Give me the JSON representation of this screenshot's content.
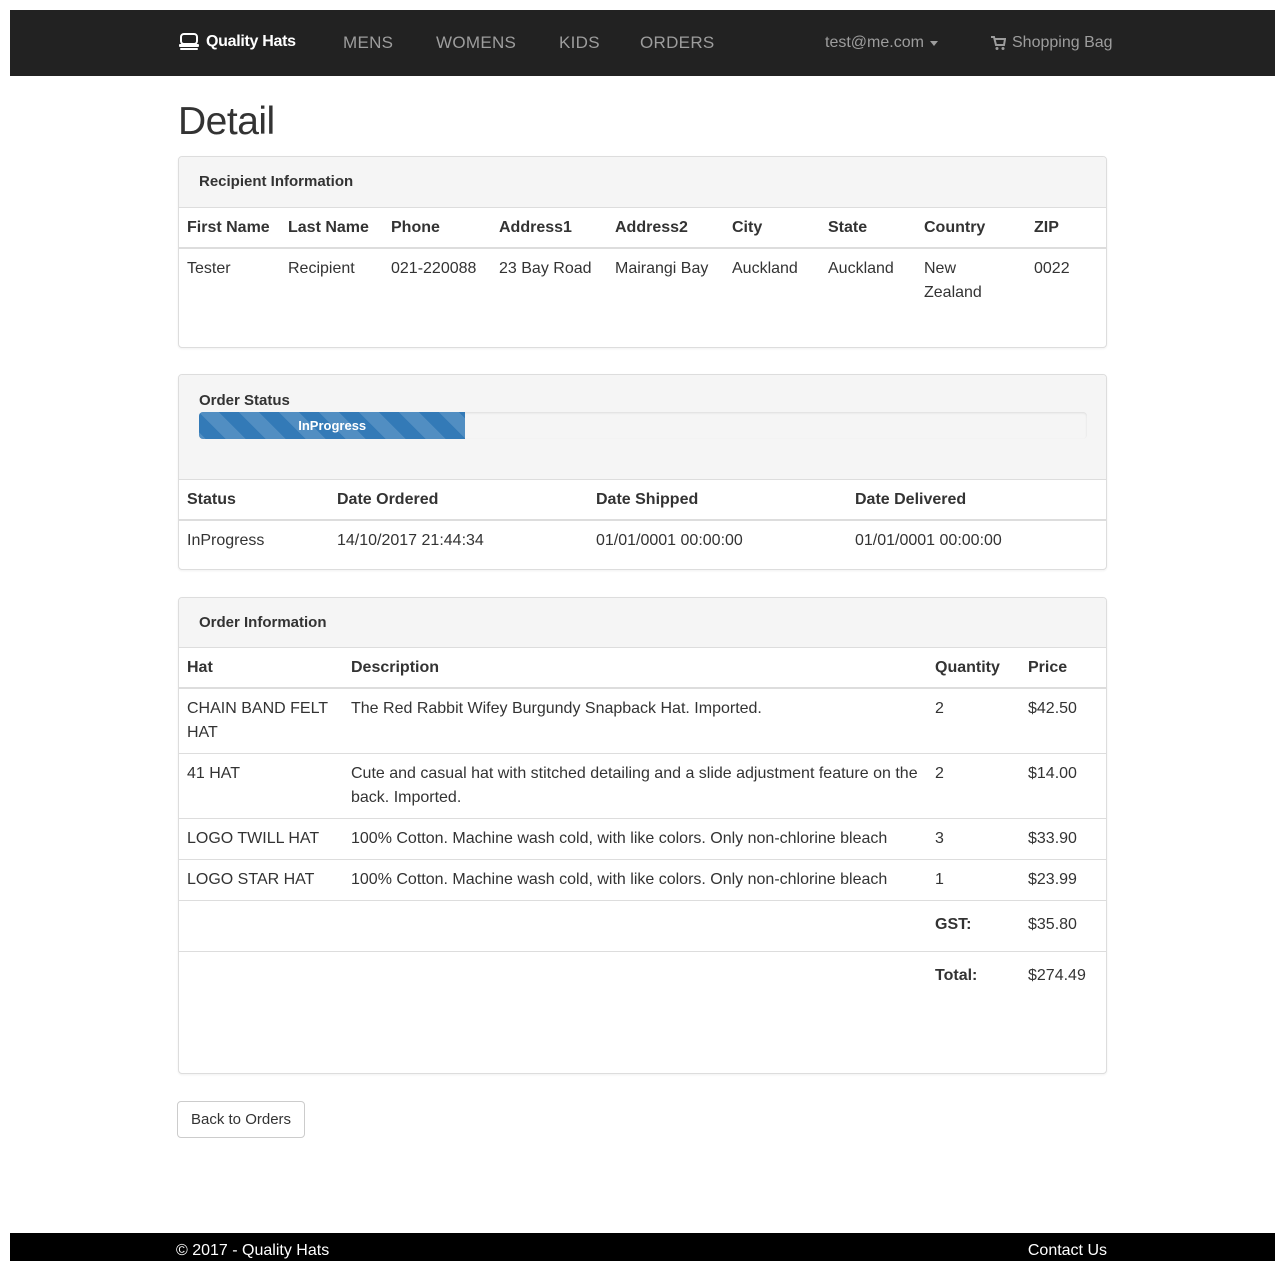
{
  "navbar": {
    "brand": "Quality Hats",
    "links": [
      "MENS",
      "WOMENS",
      "KIDS",
      "ORDERS"
    ],
    "user": "test@me.com",
    "bag": "Shopping Bag"
  },
  "page_title": "Detail",
  "recipient": {
    "heading": "Recipient Information",
    "headers": [
      "First Name",
      "Last Name",
      "Phone",
      "Address1",
      "Address2",
      "City",
      "State",
      "Country",
      "ZIP"
    ],
    "row": [
      "Tester",
      "Recipient",
      "021-220088",
      "23 Bay Road",
      "Mairangi Bay",
      "Auckland",
      "Auckland",
      "New Zealand",
      "0022"
    ]
  },
  "status": {
    "heading": "Order Status",
    "progress_label": "InProgress",
    "progress_fraction": 0.3,
    "headers": [
      "Status",
      "Date Ordered",
      "Date Shipped",
      "Date Delivered"
    ],
    "row": [
      "InProgress",
      "14/10/2017 21:44:34",
      "01/01/0001 00:00:00",
      "01/01/0001 00:00:00"
    ]
  },
  "order": {
    "heading": "Order Information",
    "headers": [
      "Hat",
      "Description",
      "Quantity",
      "Price"
    ],
    "items": [
      {
        "hat": "CHAIN BAND FELT HAT",
        "description": "The Red Rabbit Wifey Burgundy Snapback Hat. Imported.",
        "quantity": "2",
        "price": "$42.50"
      },
      {
        "hat": "41 HAT",
        "description": "Cute and casual hat with stitched detailing and a slide adjustment feature on the back. Imported.",
        "quantity": "2",
        "price": "$14.00"
      },
      {
        "hat": "LOGO TWILL HAT",
        "description": "100% Cotton. Machine wash cold, with like colors. Only non-chlorine bleach",
        "quantity": "3",
        "price": "$33.90"
      },
      {
        "hat": "LOGO STAR HAT",
        "description": "100% Cotton. Machine wash cold, with like colors. Only non-chlorine bleach",
        "quantity": "1",
        "price": "$23.99"
      }
    ],
    "gst_label": "GST:",
    "gst_value": "$35.80",
    "total_label": "Total:",
    "total_value": "$274.49"
  },
  "back_button": "Back to Orders",
  "footer": {
    "copyright": "© 2017 - Quality Hats",
    "contact": "Contact Us"
  }
}
